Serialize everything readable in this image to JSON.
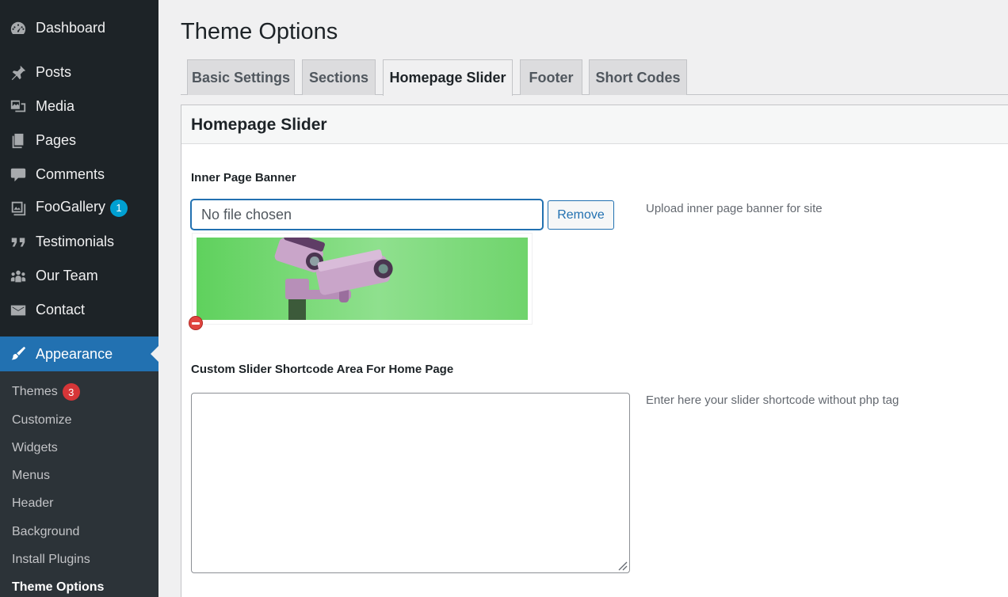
{
  "sidebar": {
    "items": [
      {
        "label": "Dashboard",
        "icon": "dashboard-icon"
      },
      {
        "label": "Posts",
        "icon": "pin-icon"
      },
      {
        "label": "Media",
        "icon": "media-icon"
      },
      {
        "label": "Pages",
        "icon": "pages-icon"
      },
      {
        "label": "Comments",
        "icon": "comment-icon"
      },
      {
        "label": "FooGallery",
        "icon": "gallery-icon",
        "badge": "1"
      },
      {
        "label": "Testimonials",
        "icon": "quote-icon"
      },
      {
        "label": "Our Team",
        "icon": "team-icon"
      },
      {
        "label": "Contact",
        "icon": "mail-icon"
      }
    ],
    "active": {
      "label": "Appearance",
      "icon": "brush-icon"
    },
    "submenu": [
      {
        "label": "Themes",
        "badge": "3"
      },
      {
        "label": "Customize"
      },
      {
        "label": "Widgets"
      },
      {
        "label": "Menus"
      },
      {
        "label": "Header"
      },
      {
        "label": "Background"
      },
      {
        "label": "Install Plugins"
      },
      {
        "label": "Theme Options",
        "current": true
      }
    ]
  },
  "page_title": "Theme Options",
  "tabs": [
    "Basic Settings",
    "Sections",
    "Homepage Slider",
    "Footer",
    "Short Codes"
  ],
  "active_tab": "Homepage Slider",
  "panel": {
    "title": "Homepage Slider",
    "banner_label": "Inner Page Banner",
    "file_value": "No file chosen",
    "remove_label": "Remove",
    "banner_hint": "Upload inner page banner for site",
    "shortcode_label": "Custom Slider Shortcode Area For Home Page",
    "shortcode_value": "",
    "shortcode_hint": "Enter here your slider shortcode without php tag"
  },
  "colors": {
    "sidebar_bg": "#1d2327",
    "accent": "#2271b1",
    "badge_blue": "#00a0d2",
    "badge_red": "#d63638",
    "banner_green": "#6fd46c"
  }
}
